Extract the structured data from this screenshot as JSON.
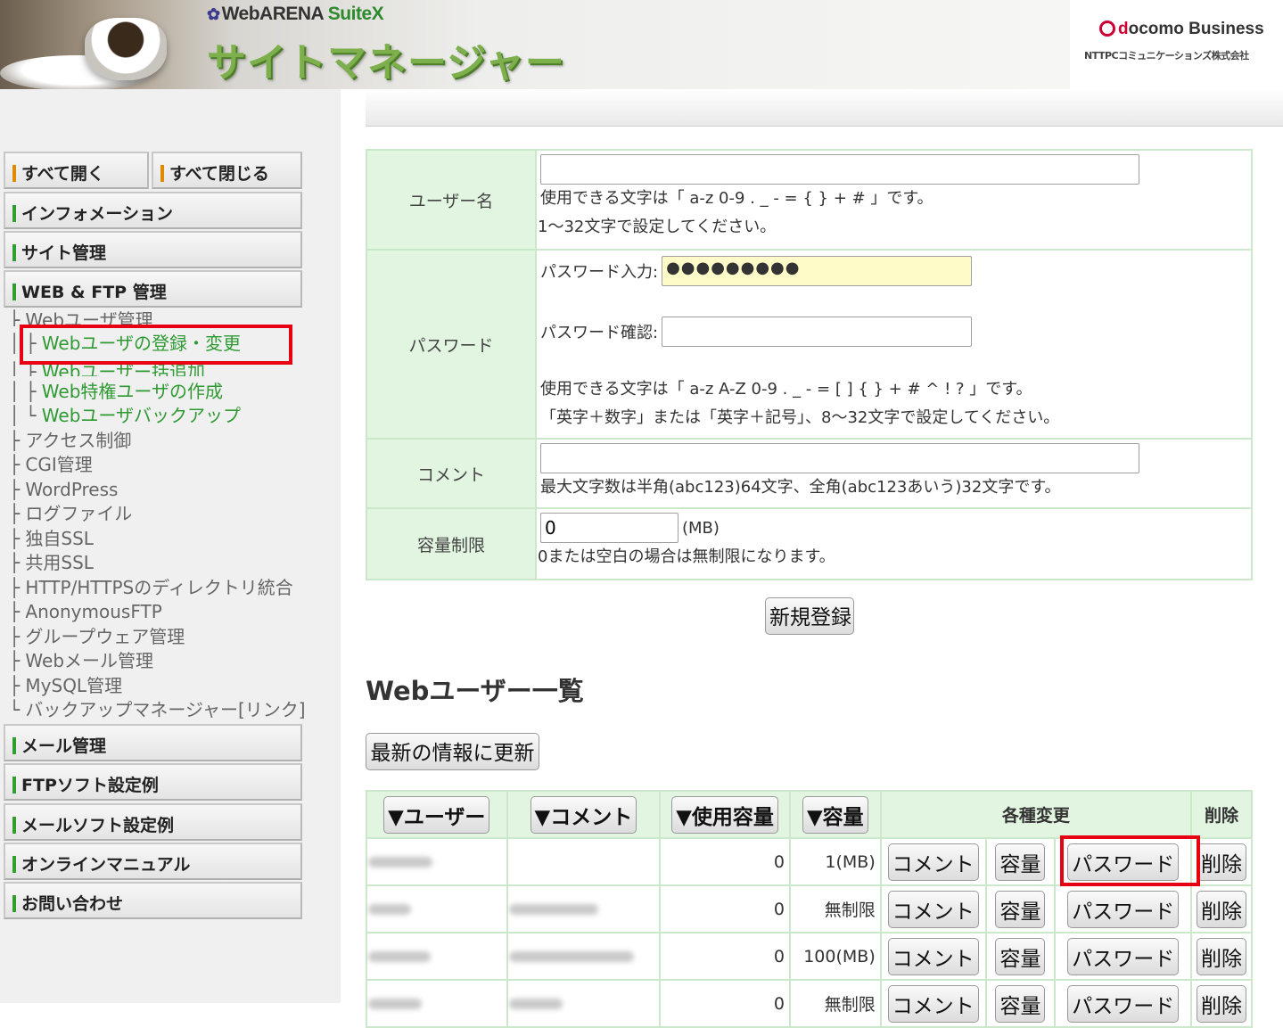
{
  "header": {
    "brand_small_mark": "✿",
    "brand_small": "WebARENA ",
    "brand_suite": "SuiteX",
    "app_title": "サイトマネージャー",
    "corp_docomo_d": "d",
    "corp_docomo_rest": "ocomo Business",
    "corp_name": "NTTPCコミュニケーションズ株式会社"
  },
  "sidebar": {
    "open_all": "すべて開く",
    "close_all": "すべて閉じる",
    "sections": {
      "information": "インフォメーション",
      "site_management": "サイト管理",
      "web_ftp": "WEB & FTP 管理",
      "mail_management": "メール管理",
      "ftp_soft": "FTPソフト設定例",
      "mail_soft": "メールソフト設定例",
      "online_manual": "オンラインマニュアル",
      "contact": "お問い合わせ"
    },
    "tree": {
      "web_user_mgmt": "Webユーザ管理",
      "web_user_register": "Webユーザの登録・変更",
      "web_user_bulk": "Webユーザー括追加",
      "web_privileged": "Web特権ユーザの作成",
      "web_user_backup": "Webユーザバックアップ",
      "access_control": "アクセス制御",
      "cgi": "CGI管理",
      "wordpress": "WordPress",
      "logfile": "ログファイル",
      "own_ssl": "独自SSL",
      "shared_ssl": "共用SSL",
      "https_merge": "HTTP/HTTPSのディレクトリ統合",
      "anon_ftp": "AnonymousFTP",
      "groupware": "グループウェア管理",
      "webmail": "Webメール管理",
      "mysql": "MySQL管理",
      "backup_manager": "バックアップマネージャー[リンク]"
    }
  },
  "form": {
    "username_label": "ユーザー名",
    "username_value": "",
    "username_help1": "使用できる文字は「 a-z 0-9 . _ - = { } + # 」です。",
    "username_help2": "1～32文字で設定してください。",
    "password_label": "パスワード",
    "password_input_label": "パスワード入力:",
    "password_value": "●●●●●●●●●",
    "password_confirm_label": "パスワード確認:",
    "password_confirm_value": "",
    "password_help1": "使用できる文字は「 a-z A-Z 0-9 . _ - = [ ] { } + # ^ ! ? 」です。",
    "password_help2": "「英字＋数字」または「英字＋記号」、8～32文字で設定してください。",
    "comment_label": "コメント",
    "comment_value": "",
    "comment_help": "最大文字数は半角(abc123)64文字、全角(abc123あいう)32文字です。",
    "quota_label": "容量制限",
    "quota_value": "0",
    "quota_unit": "(MB)",
    "quota_help": "0または空白の場合は無制限になります。",
    "register_button": "新規登録"
  },
  "list": {
    "title": "Webユーザー一覧",
    "refresh_button": "最新の情報に更新",
    "headers": {
      "user": "▼ユーザー",
      "comment": "▼コメント",
      "usage": "▼使用容量",
      "quota": "▼容量",
      "changes": "各種変更",
      "delete": "削除"
    },
    "rows": [
      {
        "usage": "0",
        "quota": "1(MB)"
      },
      {
        "usage": "0",
        "quota": "無制限"
      },
      {
        "usage": "0",
        "quota": "100(MB)"
      },
      {
        "usage": "0",
        "quota": "無制限"
      }
    ],
    "row_buttons": {
      "comment": "コメント",
      "quota": "容量",
      "password": "パスワード",
      "delete": "削除"
    }
  },
  "colors": {
    "highlight": "#e60012",
    "green_bar": "#2fa02f",
    "orange_bar": "#e08a00",
    "table_label_bg": "#e1f5e1",
    "password_fill": "#fffbc8",
    "tree_link": "#2f9a33"
  }
}
